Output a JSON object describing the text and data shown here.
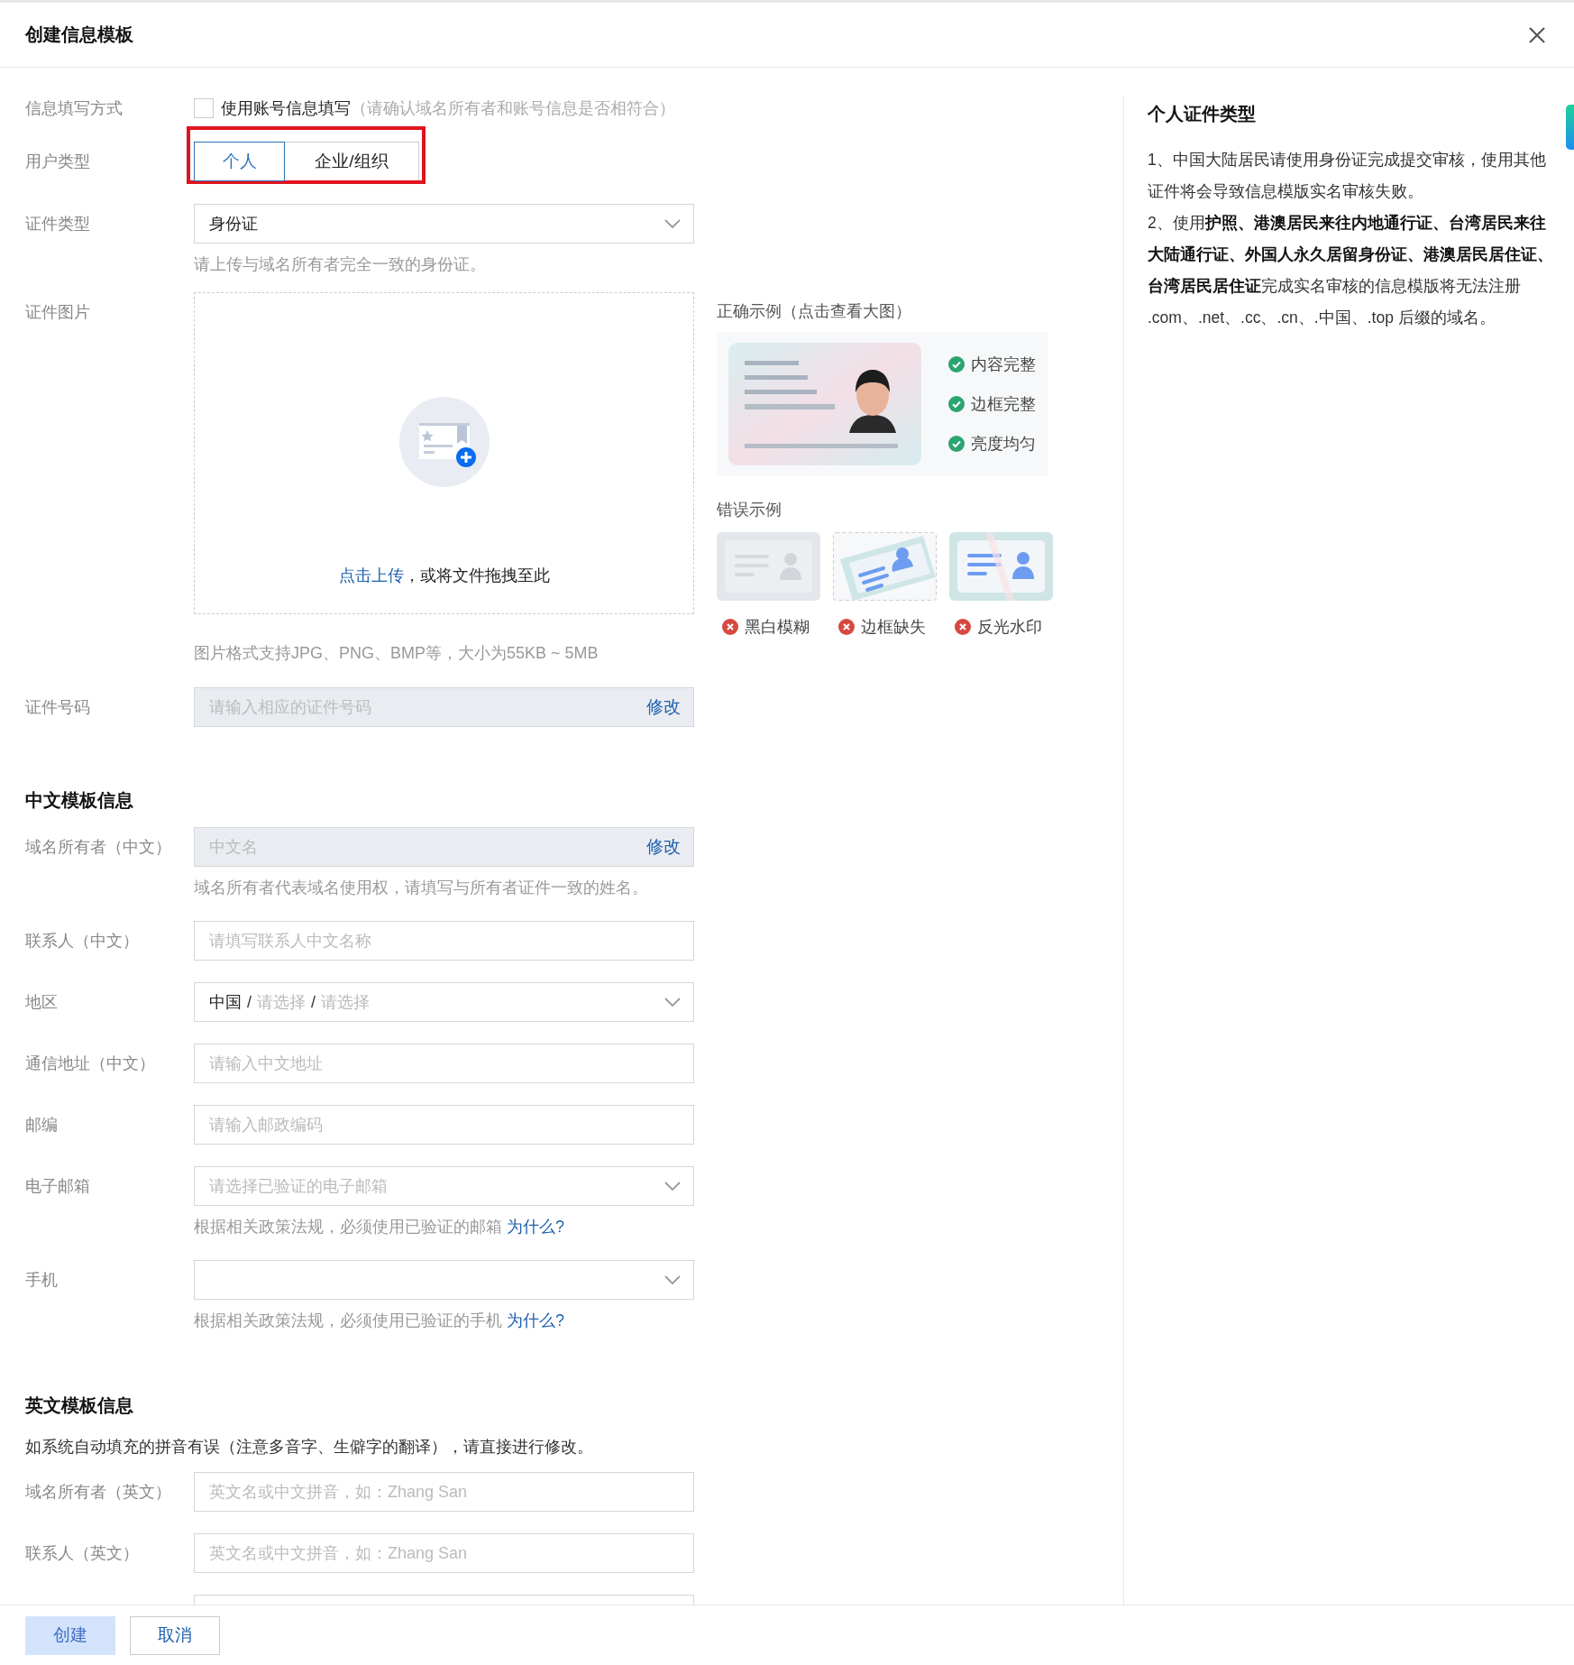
{
  "dialog": {
    "title": "创建信息模板"
  },
  "fill_method": {
    "label": "信息填写方式",
    "checkbox_label": "使用账号信息填写",
    "checked": false,
    "note": "（请确认域名所有者和账号信息是否相符合）"
  },
  "user_type": {
    "label": "用户类型",
    "highlighted": true,
    "options": [
      {
        "label": "个人",
        "selected": true
      },
      {
        "label": "企业/组织",
        "selected": false
      }
    ]
  },
  "id_type": {
    "label": "证件类型",
    "value": "身份证",
    "hint": "请上传与域名所有者完全一致的身份证。"
  },
  "id_image": {
    "label": "证件图片",
    "upload_link": "点击上传",
    "upload_text": "，或将文件拖拽至此",
    "hint": "图片格式支持JPG、PNG、BMP等，大小为55KB ~ 5MB"
  },
  "examples": {
    "correct_title": "正确示例（点击查看大图）",
    "checks": [
      "内容完整",
      "边框完整",
      "亮度均匀"
    ],
    "wrong_title": "错误示例",
    "wrong": [
      {
        "kind": "blurry",
        "label": "黑白模糊"
      },
      {
        "kind": "cropped",
        "label": "边框缺失"
      },
      {
        "kind": "glare",
        "label": "反光水印"
      }
    ]
  },
  "id_number": {
    "kind": "locked",
    "label": "证件号码",
    "placeholder": "请输入相应的证件号码",
    "action": "修改"
  },
  "sections": [
    {
      "title": "中文模板信息",
      "fields": [
        {
          "kind": "locked",
          "label": "域名所有者（中文）",
          "placeholder": "中文名",
          "action": "修改",
          "hint": "域名所有者代表域名使用权，请填写与所有者证件一致的姓名。"
        },
        {
          "kind": "text",
          "label": "联系人（中文）",
          "placeholder": "请填写联系人中文名称"
        },
        {
          "kind": "region",
          "label": "地区",
          "value": "中国",
          "separator": "/",
          "parts": [
            "请选择",
            "请选择"
          ]
        },
        {
          "kind": "text",
          "label": "通信地址（中文）",
          "placeholder": "请输入中文地址"
        },
        {
          "kind": "text",
          "label": "邮编",
          "placeholder": "请输入邮政编码"
        },
        {
          "kind": "select",
          "label": "电子邮箱",
          "placeholder": "请选择已验证的电子邮箱",
          "hint": "根据相关政策法规，必须使用已验证的邮箱",
          "hint_link": "为什么?"
        },
        {
          "kind": "select",
          "label": "手机",
          "hint": "根据相关政策法规，必须使用已验证的手机",
          "hint_link": "为什么?"
        }
      ]
    },
    {
      "title": "英文模板信息",
      "note": "如系统自动填充的拼音有误（注意多音字、生僻字的翻译），请直接进行修改。",
      "fields": [
        {
          "kind": "text",
          "label": "域名所有者（英文）",
          "placeholder": "英文名或中文拼音，如：Zhang San"
        },
        {
          "kind": "text",
          "label": "联系人（英文）",
          "placeholder": "英文名或中文拼音，如：Zhang San"
        },
        {
          "kind": "text"
        }
      ]
    }
  ],
  "help": {
    "title": "个人证件类型",
    "paragraphs": [
      "1、中国大陆居民请使用身份证完成提交审核，使用其他证件将会导致信息模版实名审核失败。",
      "2、使用**护照、港澳居民来往内地通行证、台湾居民来往大陆通行证、外国人永久居留身份证、港澳居民居住证、台湾居民居住证**完成实名审核的信息模版将无法注册 .com、.net、.cc、.cn、.中国、.top 后缀的域名。"
    ]
  },
  "footer": {
    "buttons": [
      {
        "label": "创建",
        "disabled": true
      },
      {
        "label": "取消",
        "disabled": false
      }
    ]
  }
}
